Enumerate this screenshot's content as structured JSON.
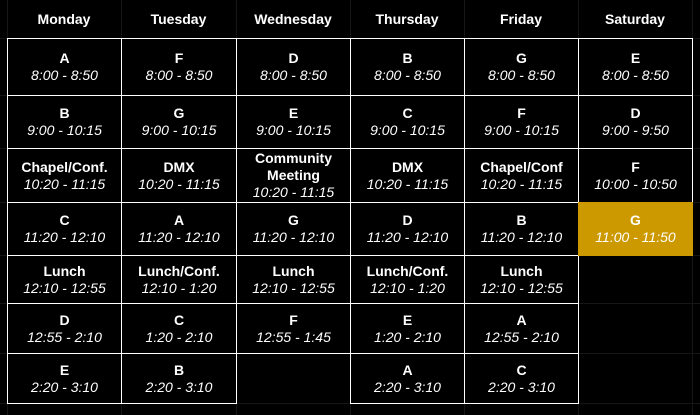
{
  "days": [
    "Monday",
    "Tuesday",
    "Wednesday",
    "Thursday",
    "Friday",
    "Saturday"
  ],
  "highlight_color": "#cc9900",
  "schedule": [
    [
      {
        "name": "A",
        "time": "8:00 - 8:50"
      },
      {
        "name": "B",
        "time": "9:00 - 10:15"
      },
      {
        "name": "Chapel/Conf.",
        "time": "10:20 - 11:15"
      },
      {
        "name": "C",
        "time": "11:20 - 12:10"
      },
      {
        "name": "Lunch",
        "time": "12:10 - 12:55"
      },
      {
        "name": "D",
        "time": "12:55 - 2:10"
      },
      {
        "name": "E",
        "time": "2:20 - 3:10"
      }
    ],
    [
      {
        "name": "F",
        "time": "8:00 - 8:50"
      },
      {
        "name": "G",
        "time": "9:00 - 10:15"
      },
      {
        "name": "DMX",
        "time": "10:20 - 11:15"
      },
      {
        "name": "A",
        "time": "11:20 - 12:10"
      },
      {
        "name": "Lunch/Conf.",
        "time": "12:10 - 1:20"
      },
      {
        "name": "C",
        "time": "1:20 - 2:10"
      },
      {
        "name": "B",
        "time": "2:20 - 3:10"
      }
    ],
    [
      {
        "name": "D",
        "time": "8:00 - 8:50"
      },
      {
        "name": "E",
        "time": "9:00 - 10:15"
      },
      {
        "name": "Community Meeting",
        "time": "10:20 - 11:15"
      },
      {
        "name": "G",
        "time": "11:20 - 12:10"
      },
      {
        "name": "Lunch",
        "time": "12:10 - 12:55"
      },
      {
        "name": "F",
        "time": "12:55 - 1:45"
      },
      null
    ],
    [
      {
        "name": "B",
        "time": "8:00 - 8:50"
      },
      {
        "name": "C",
        "time": "9:00 - 10:15"
      },
      {
        "name": "DMX",
        "time": "10:20 - 11:15"
      },
      {
        "name": "D",
        "time": "11:20 - 12:10"
      },
      {
        "name": "Lunch/Conf.",
        "time": "12:10 - 1:20"
      },
      {
        "name": "E",
        "time": "1:20 - 2:10"
      },
      {
        "name": "A",
        "time": "2:20 - 3:10"
      }
    ],
    [
      {
        "name": "G",
        "time": "8:00 - 8:50"
      },
      {
        "name": "F",
        "time": "9:00 - 10:15"
      },
      {
        "name": "Chapel/Conf",
        "time": "10:20 - 11:15"
      },
      {
        "name": "B",
        "time": "11:20 - 12:10"
      },
      {
        "name": "Lunch",
        "time": "12:10 - 12:55"
      },
      {
        "name": "A",
        "time": "12:55 - 2:10"
      },
      {
        "name": "C",
        "time": "2:20 - 3:10"
      }
    ],
    [
      {
        "name": "E",
        "time": "8:00 - 8:50"
      },
      {
        "name": "D",
        "time": "9:00 - 9:50"
      },
      {
        "name": "F",
        "time": "10:00 - 10:50"
      },
      {
        "name": "G",
        "time": "11:00 - 11:50",
        "highlighted": true
      },
      null,
      null,
      null
    ]
  ]
}
